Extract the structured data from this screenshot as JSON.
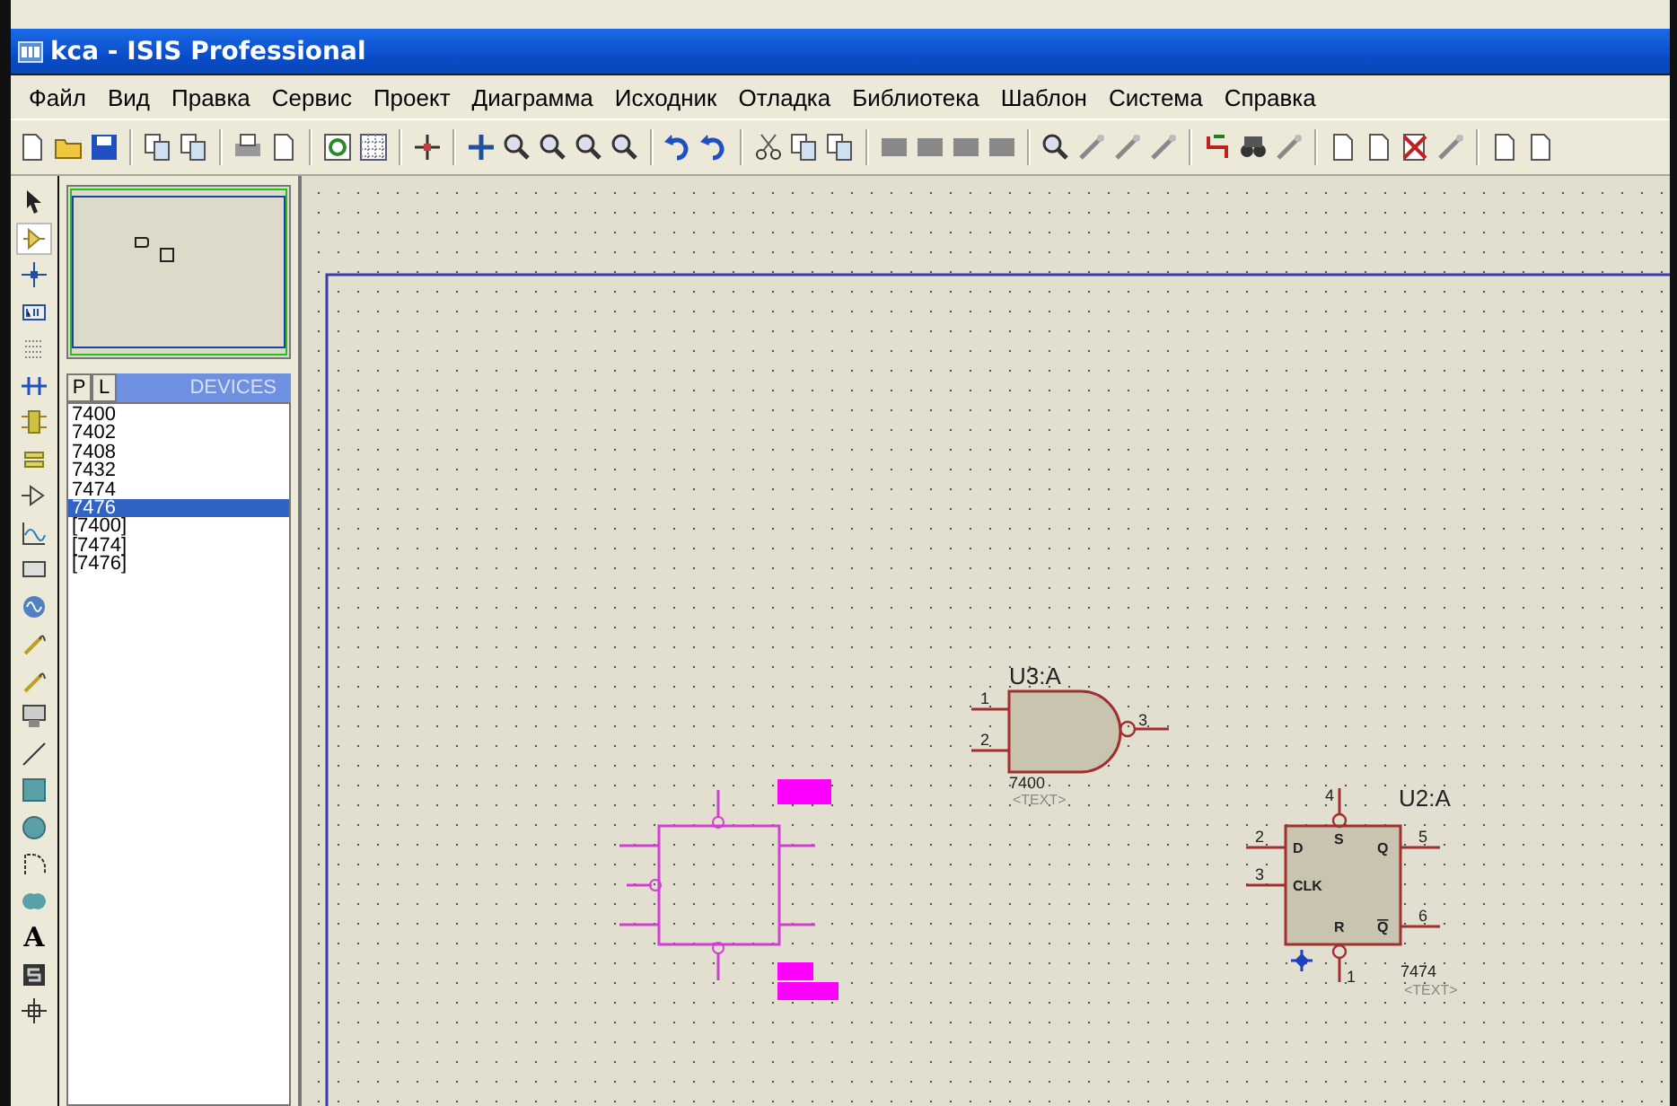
{
  "window": {
    "title": "kca - ISIS Professional"
  },
  "menu": [
    "Файл",
    "Вид",
    "Правка",
    "Сервис",
    "Проект",
    "Диаграмма",
    "Исходник",
    "Отладка",
    "Библиотека",
    "Шаблон",
    "Система",
    "Справка"
  ],
  "left_tools": [
    {
      "kind": "arrow",
      "selected": false
    },
    {
      "kind": "component",
      "selected": true
    },
    {
      "kind": "junction",
      "selected": false
    },
    {
      "kind": "label",
      "selected": false
    },
    {
      "kind": "script",
      "selected": false
    },
    {
      "kind": "bus",
      "selected": false
    },
    {
      "kind": "subcircuit",
      "selected": false
    },
    {
      "kind": "terminal",
      "selected": false
    },
    {
      "kind": "pin",
      "selected": false
    },
    {
      "kind": "graph",
      "selected": false
    },
    {
      "kind": "tape",
      "selected": false
    },
    {
      "kind": "generator",
      "selected": false
    },
    {
      "kind": "vprobe",
      "selected": false
    },
    {
      "kind": "iprobe",
      "selected": false
    },
    {
      "kind": "instrument",
      "selected": false
    },
    {
      "kind": "line",
      "selected": false
    },
    {
      "kind": "box",
      "selected": false
    },
    {
      "kind": "circle",
      "selected": false
    },
    {
      "kind": "arc",
      "selected": false
    },
    {
      "kind": "path",
      "selected": false
    },
    {
      "kind": "text",
      "glyph": "A",
      "selected": false
    },
    {
      "kind": "symbol",
      "selected": false
    },
    {
      "kind": "marker",
      "selected": false
    }
  ],
  "devices": {
    "tabs": [
      {
        "label": "P",
        "selected": false
      },
      {
        "label": "L",
        "selected": false
      }
    ],
    "title": "DEVICES",
    "items": [
      {
        "label": "7400",
        "selected": false
      },
      {
        "label": "7402",
        "selected": false
      },
      {
        "label": "7408",
        "selected": false
      },
      {
        "label": "7432",
        "selected": false
      },
      {
        "label": "7474",
        "selected": false
      },
      {
        "label": "7476",
        "selected": true
      },
      {
        "label": "[7400]",
        "selected": false
      },
      {
        "label": "[7474]",
        "selected": false
      },
      {
        "label": "[7476]",
        "selected": false
      }
    ]
  },
  "schematic": {
    "gate": {
      "ref": "U3:A",
      "part": "7400",
      "text": "<TEXT>",
      "pins": [
        "1",
        "2",
        "3"
      ]
    },
    "flipflop": {
      "ref": "U2:A",
      "part": "7474",
      "text": "<TEXT>",
      "pins": {
        "d": "2",
        "clk": "3",
        "q": "5",
        "qbar": "6",
        "s": "4",
        "r": "1"
      },
      "labels": {
        "d": "D",
        "clk": "CLK",
        "q": "Q",
        "qbar": "Q",
        "s": "S",
        "r": "R"
      }
    }
  }
}
